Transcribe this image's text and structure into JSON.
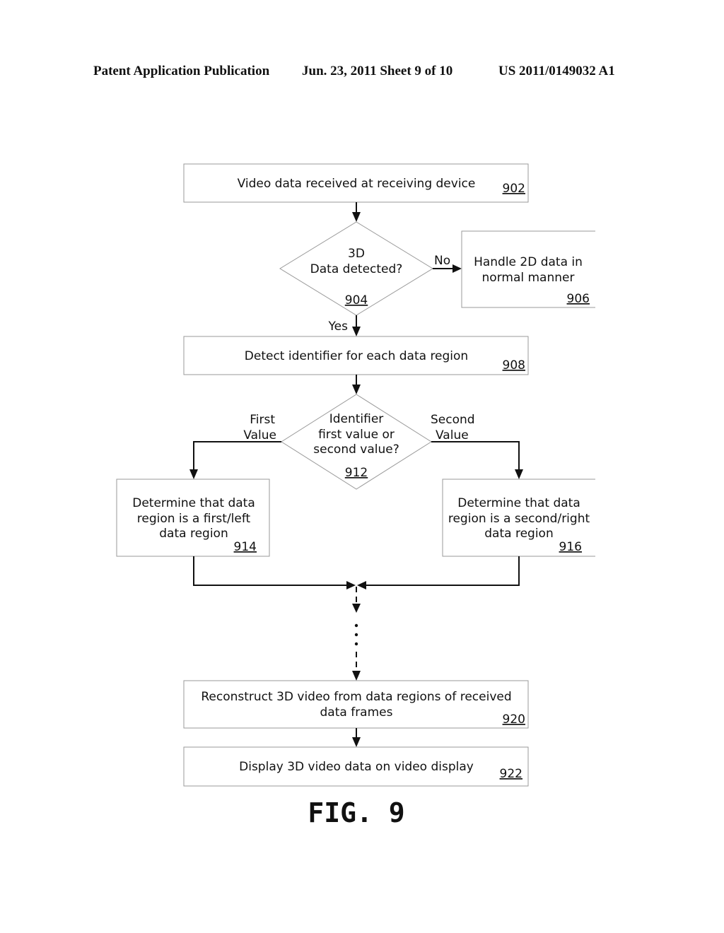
{
  "header": {
    "publication": "Patent Application Publication",
    "date_sheet": "Jun. 23, 2011  Sheet 9 of 10",
    "number": "US 2011/0149032 A1"
  },
  "nodes": {
    "n902": {
      "lines": [
        "Video data received at receiving device"
      ],
      "ref": "902"
    },
    "n904": {
      "lines": [
        "3D",
        "Data detected?"
      ],
      "ref": "904"
    },
    "n906": {
      "lines": [
        "Handle 2D data in",
        "normal manner"
      ],
      "ref": "906"
    },
    "n908": {
      "lines": [
        "Detect identifier for each data region"
      ],
      "ref": "908"
    },
    "n912": {
      "lines": [
        "Identifier",
        "first value or",
        "second value?"
      ],
      "ref": "912"
    },
    "n914": {
      "lines": [
        "Determine that data",
        "region is a first/left",
        "data region"
      ],
      "ref": "914"
    },
    "n916": {
      "lines": [
        "Determine that data",
        "region is a second/right",
        "data region"
      ],
      "ref": "916"
    },
    "n920": {
      "lines": [
        "Reconstruct 3D video from data regions of received",
        "data frames"
      ],
      "ref": "920"
    },
    "n922": {
      "lines": [
        "Display 3D video data on video display"
      ],
      "ref": "922"
    }
  },
  "edge_labels": {
    "no": "No",
    "yes": "Yes",
    "first_value": [
      "First",
      "Value"
    ],
    "second_value": [
      "Second",
      "Value"
    ]
  },
  "figure_label": "FIG. 9"
}
